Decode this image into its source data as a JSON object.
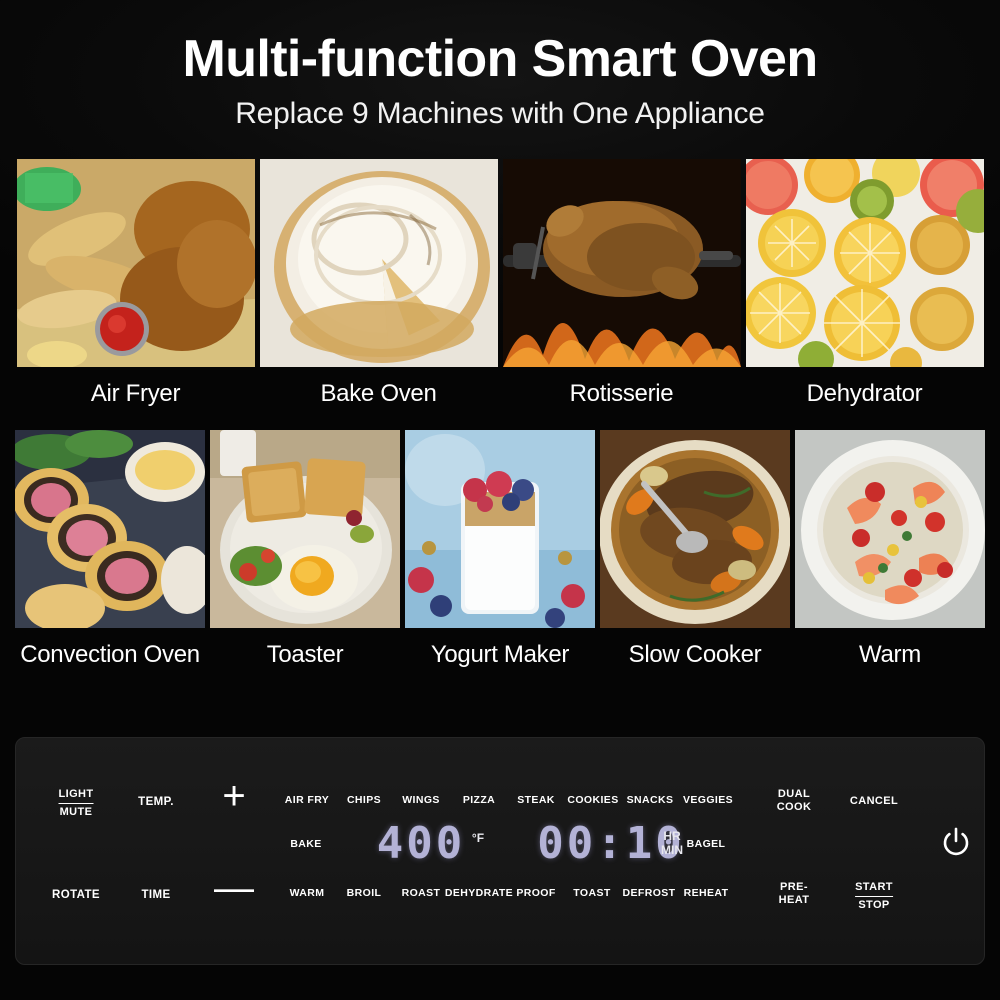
{
  "header": {
    "title": "Multi-function Smart Oven",
    "subtitle": "Replace 9 Machines with One Appliance"
  },
  "gallery": {
    "row1": [
      {
        "caption": "Air Fryer",
        "image": "fried-chicken-and-potato-wedges-with-ketchup"
      },
      {
        "caption": "Bake Oven",
        "image": "meringue-topped-tart-with-slice-cut"
      },
      {
        "caption": "Rotisserie",
        "image": "whole-chicken-on-rotisserie-spit-over-flames"
      },
      {
        "caption": "Dehydrator",
        "image": "dried-citrus-and-kiwi-slices"
      }
    ],
    "row2": [
      {
        "caption": "Convection Oven",
        "image": "sliced-beef-wellington-with-sauce"
      },
      {
        "caption": "Toaster",
        "image": "toasted-bread-with-fried-egg-and-salad"
      },
      {
        "caption": "Yogurt Maker",
        "image": "yogurt-parfait-with-berries-and-granola"
      },
      {
        "caption": "Slow Cooker",
        "image": "pot-roast-with-carrots-and-potatoes"
      },
      {
        "caption": "Warm",
        "image": "shrimp-and-corn-rice-bowl"
      }
    ]
  },
  "control_panel": {
    "left_controls": [
      {
        "id": "light-mute",
        "lines": [
          "LIGHT",
          "MUTE"
        ],
        "divider": true
      },
      {
        "id": "temp",
        "lines": [
          "TEMP."
        ],
        "divider": false
      },
      {
        "id": "rotate",
        "lines": [
          "ROTATE"
        ],
        "divider": false
      },
      {
        "id": "time",
        "lines": [
          "TIME"
        ],
        "divider": false
      }
    ],
    "steppers": {
      "increase": "+",
      "decrease": "—"
    },
    "presets_top": [
      "AIR FRY",
      "CHIPS",
      "WINGS",
      "PIZZA",
      "STEAK",
      "COOKIES",
      "SNACKS",
      "VEGGIES"
    ],
    "presets_middle": [
      "BAKE",
      "BAGEL"
    ],
    "presets_bottom": [
      "WARM",
      "BROIL",
      "ROAST",
      "DEHYDRATE",
      "PROOF",
      "TOAST",
      "DEFROST",
      "REHEAT"
    ],
    "right_controls": [
      {
        "id": "dual-cook",
        "lines": [
          "DUAL",
          "COOK"
        ],
        "divider": false
      },
      {
        "id": "cancel",
        "lines": [
          "CANCEL"
        ],
        "divider": false
      },
      {
        "id": "pre-heat",
        "lines": [
          "PRE-",
          "HEAT"
        ],
        "divider": false
      },
      {
        "id": "start-stop",
        "lines": [
          "START",
          "STOP"
        ],
        "divider": true
      }
    ],
    "display": {
      "temperature_value": "400",
      "temperature_unit": "°F",
      "timer_value": "00:10",
      "timer_unit_lines": [
        "HR",
        "MIN"
      ],
      "segment_color": "#b3b2d6"
    },
    "power_icon": "power-icon"
  },
  "colors": {
    "background": "#050505",
    "panel": "#1b1b1b",
    "text": "#ffffff",
    "display": "#b3b2d6"
  }
}
